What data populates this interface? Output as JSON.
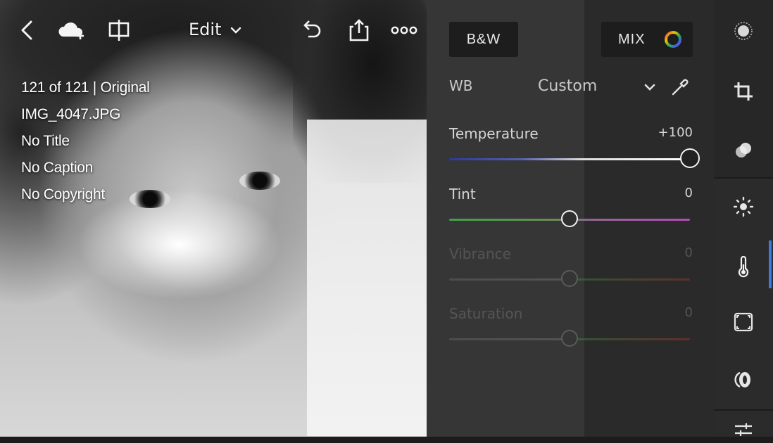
{
  "toolbar": {
    "edit_label": "Edit",
    "icons": [
      "back-chevron-icon",
      "cloud-add-icon",
      "compare-split-icon",
      "chevron-down-icon",
      "undo-icon",
      "share-icon",
      "more-icon"
    ]
  },
  "photo_info": {
    "count": "121 of 121 | Original",
    "filename": "IMG_4047.JPG",
    "title": "No Title",
    "caption": "No Caption",
    "copyright": "No Copyright"
  },
  "panel": {
    "bw_label": "B&W",
    "mix_label": "MIX",
    "wb_label": "WB",
    "wb_value": "Custom",
    "sliders": [
      {
        "label": "Temperature",
        "value": "+100",
        "level": 1.0,
        "enabled": true
      },
      {
        "label": "Tint",
        "value": "0",
        "level": 0.5,
        "enabled": true
      },
      {
        "label": "Vibrance",
        "value": "0",
        "level": 0.5,
        "enabled": false
      },
      {
        "label": "Saturation",
        "value": "0",
        "level": 0.5,
        "enabled": false
      }
    ]
  },
  "rail": {
    "icons": [
      "selective-mask-icon",
      "crop-icon",
      "healing-icon",
      "light-icon",
      "color-temperature-icon",
      "effects-vignette-icon",
      "optics-lens-icon",
      "presets-sliders-icon"
    ],
    "active_icon": "color-temperature-icon",
    "accent_color": "#3d7be0"
  },
  "colors": {
    "temp_track": [
      "#2b3a9e",
      "#ffffff"
    ],
    "tint_track": [
      "#3fa04a",
      "#b44ab8"
    ],
    "mix_ring": [
      "#e84c3d",
      "#f2c200",
      "#3fae49",
      "#2f6fd6",
      "#9b3fd3"
    ]
  }
}
